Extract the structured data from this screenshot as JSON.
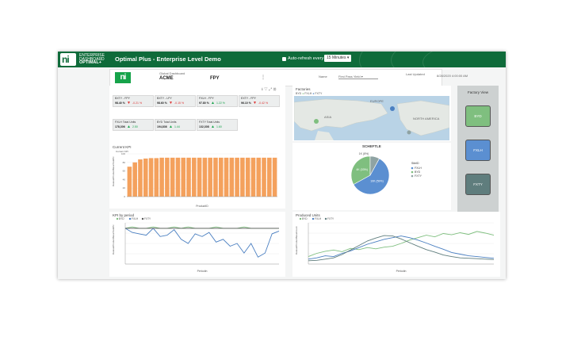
{
  "app": {
    "brand_line1": "ENTERPRISE",
    "brand_line2": "DASHBOARD",
    "brand_line3": "OPTIMAL+",
    "title": "Optimal Plus - Enterprise Level Demo",
    "auto_refresh_label": "Auto-refresh every",
    "auto_refresh_value": "15 Minutes",
    "colors": {
      "brand_green": "#0f6b3a",
      "accent_green": "#16a34a",
      "orange": "#f4a15d",
      "blue": "#4a7fc1"
    }
  },
  "header": {
    "global_dashboard_label": "Global Dashboard",
    "company": "ACME",
    "metric": "FPY",
    "menu_icon": "vertical-dots-icon",
    "filter_label": "Name",
    "filter_value": "First Pass Yield",
    "last_updated_label": "Last Updated",
    "last_updated_value": "8/28/2020 4:00:00 AM"
  },
  "kpis_top": [
    {
      "label": "BXTY - FPY",
      "value": "98.40 %",
      "direction": "down",
      "change": "-0.21 %"
    },
    {
      "label": "BXTY - LPY",
      "value": "98.60 %",
      "direction": "down",
      "change": "-0.15 %"
    },
    {
      "label": "FXLH - FPY",
      "value": "97.80 %",
      "direction": "up",
      "change": "1.22 %"
    },
    {
      "label": "EXTY - FPY",
      "value": "96.10 %",
      "direction": "down",
      "change": "-0.42 %"
    }
  ],
  "kpis_bottom": [
    {
      "label": "FXLH Total Units",
      "value": "178,306",
      "direction": "up",
      "change": "2.50"
    },
    {
      "label": "BYD Total Units",
      "value": "194,836",
      "direction": "up",
      "change": "1.44"
    },
    {
      "label": "FXTY Total Units",
      "value": "132,308",
      "direction": "up",
      "change": "1.60"
    }
  ],
  "factories": {
    "title": "Factories",
    "legend": [
      "BYD",
      "FXLH",
      "FXTY"
    ],
    "map_labels": [
      "ASIA",
      "EUROPE",
      "NORTH AMERICA"
    ]
  },
  "factory_view": {
    "title": "Factory View",
    "buttons": [
      {
        "label": "BYD",
        "color": "#7fbf7f"
      },
      {
        "label": "FXLH",
        "color": "#5b8fd1"
      },
      {
        "label": "FXTY",
        "color": "#5f7d7d"
      }
    ]
  },
  "toolbar_icons": [
    "download-icon",
    "filter-icon",
    "expand-icon",
    "settings-icon"
  ],
  "chart_data": [
    {
      "type": "bar",
      "title": "Current KPI",
      "legend": [
        "Current KPI"
      ],
      "xlabel": "ProductID",
      "ylabel": "DatasetProductBaseYieldPc",
      "ylim": [
        0,
        100
      ],
      "yticks": [
        "0",
        "20",
        "40",
        "60",
        "80",
        "100"
      ],
      "values": [
        70,
        80,
        87,
        89,
        90,
        90,
        91,
        91,
        91,
        91,
        91,
        91,
        91,
        91,
        91,
        91,
        91,
        91,
        91,
        91,
        91,
        91,
        91,
        91,
        91,
        91,
        91,
        91
      ]
    },
    {
      "type": "pie",
      "title": "SCHEFTLE",
      "legend_title": "SiteID",
      "legend": [
        "FXLH",
        "BYD",
        "FXTY"
      ],
      "slices": [
        {
          "label": "FXLH",
          "value": 59,
          "display": "10K (59%)",
          "color": "#5b8fd1"
        },
        {
          "label": "BYD",
          "value": 33,
          "display": "4K (33%)",
          "color": "#7fbf7f"
        },
        {
          "label": "FXTY",
          "value": 8,
          "display": "",
          "color": "#8fa3a3"
        }
      ],
      "callout": "1K (8%)"
    },
    {
      "type": "line",
      "title": "KPI by period",
      "legend": [
        "BYD",
        "FXLH",
        "FXTY"
      ],
      "xlabel": "Periodin",
      "ylabel": "DatasetProductBaseYieldPc",
      "ylim": [
        0.97,
        1.0
      ],
      "series": [
        {
          "name": "BYD",
          "color": "#7fbf7f",
          "values": [
            0.996,
            0.997,
            0.996,
            0.996,
            0.997,
            0.996,
            0.996,
            0.997,
            0.996,
            0.997,
            0.996,
            0.996,
            0.996,
            0.997,
            0.996,
            0.996,
            0.996,
            0.997,
            0.996,
            0.996,
            0.996,
            0.996,
            0.996
          ]
        },
        {
          "name": "FXLH",
          "color": "#4a7fc1",
          "values": [
            0.996,
            0.993,
            0.992,
            0.991,
            0.996,
            0.99,
            0.991,
            0.995,
            0.988,
            0.985,
            0.992,
            0.99,
            0.993,
            0.986,
            0.988,
            0.983,
            0.985,
            0.978,
            0.985,
            0.975,
            0.978,
            0.992,
            0.994
          ]
        },
        {
          "name": "FXTY",
          "color": "#555555",
          "values": [
            0.996,
            0.996,
            0.996,
            0.996,
            0.996,
            0.996,
            0.996,
            0.996,
            0.996,
            0.996,
            0.996,
            0.996,
            0.996,
            0.996,
            0.996,
            0.996,
            0.996,
            0.996,
            0.996,
            0.996,
            0.996,
            0.996,
            0.996
          ]
        }
      ]
    },
    {
      "type": "line",
      "title": "Produced Units",
      "legend": [
        "BYD",
        "FXLH",
        "FXTY"
      ],
      "xlabel": "Periodin",
      "ylabel": "DatasetProductBaseCount",
      "ylim": [
        0,
        10
      ],
      "series": [
        {
          "name": "BYD",
          "color": "#7fbf7f",
          "values": [
            1.8,
            2.6,
            3.1,
            3.4,
            3.0,
            3.8,
            3.5,
            4.0,
            3.7,
            4.1,
            4.3,
            5.0,
            5.8,
            6.4,
            7.0,
            6.6,
            7.4,
            7.1,
            7.6,
            7.2,
            7.9,
            7.5,
            7.0
          ]
        },
        {
          "name": "FXLH",
          "color": "#4a7fc1",
          "values": [
            1.2,
            1.5,
            2.0,
            1.8,
            2.6,
            3.2,
            4.0,
            4.8,
            5.4,
            6.0,
            6.4,
            6.8,
            6.4,
            5.8,
            5.1,
            4.3,
            3.6,
            2.8,
            2.4,
            2.0,
            1.8,
            1.6,
            1.4
          ]
        },
        {
          "name": "FXTY",
          "color": "#5f7d7d",
          "values": [
            0.8,
            0.9,
            1.2,
            1.5,
            2.3,
            3.4,
            4.5,
            5.6,
            6.3,
            6.9,
            6.8,
            6.1,
            5.2,
            4.3,
            3.5,
            2.9,
            2.2,
            1.8,
            1.5,
            1.4,
            1.3,
            1.2,
            1.1
          ]
        }
      ]
    }
  ]
}
